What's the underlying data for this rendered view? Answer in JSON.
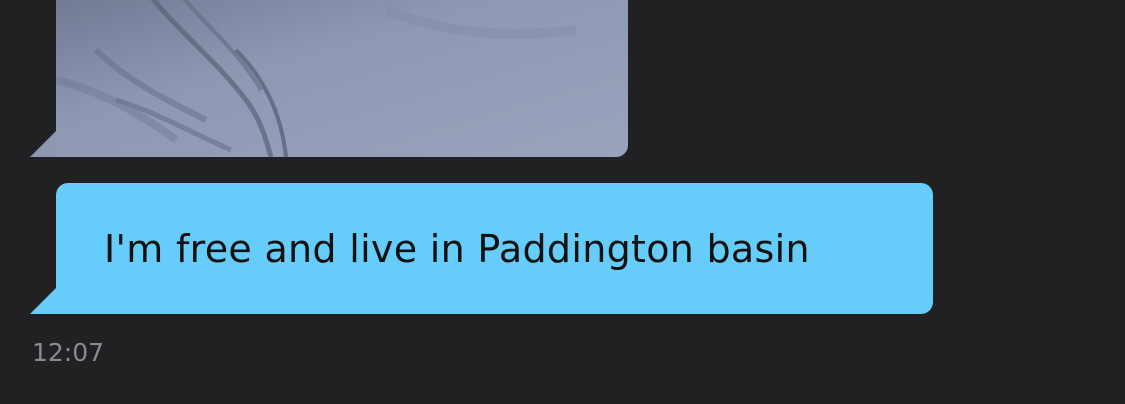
{
  "messages": [
    {
      "type": "photo",
      "alt": ""
    },
    {
      "type": "text",
      "text": "I'm free and live in Paddington basin",
      "time": "12:07"
    }
  ],
  "colors": {
    "background": "#212023",
    "incoming_bubble": "#66cdfb",
    "timestamp": "#8a8a8e"
  }
}
